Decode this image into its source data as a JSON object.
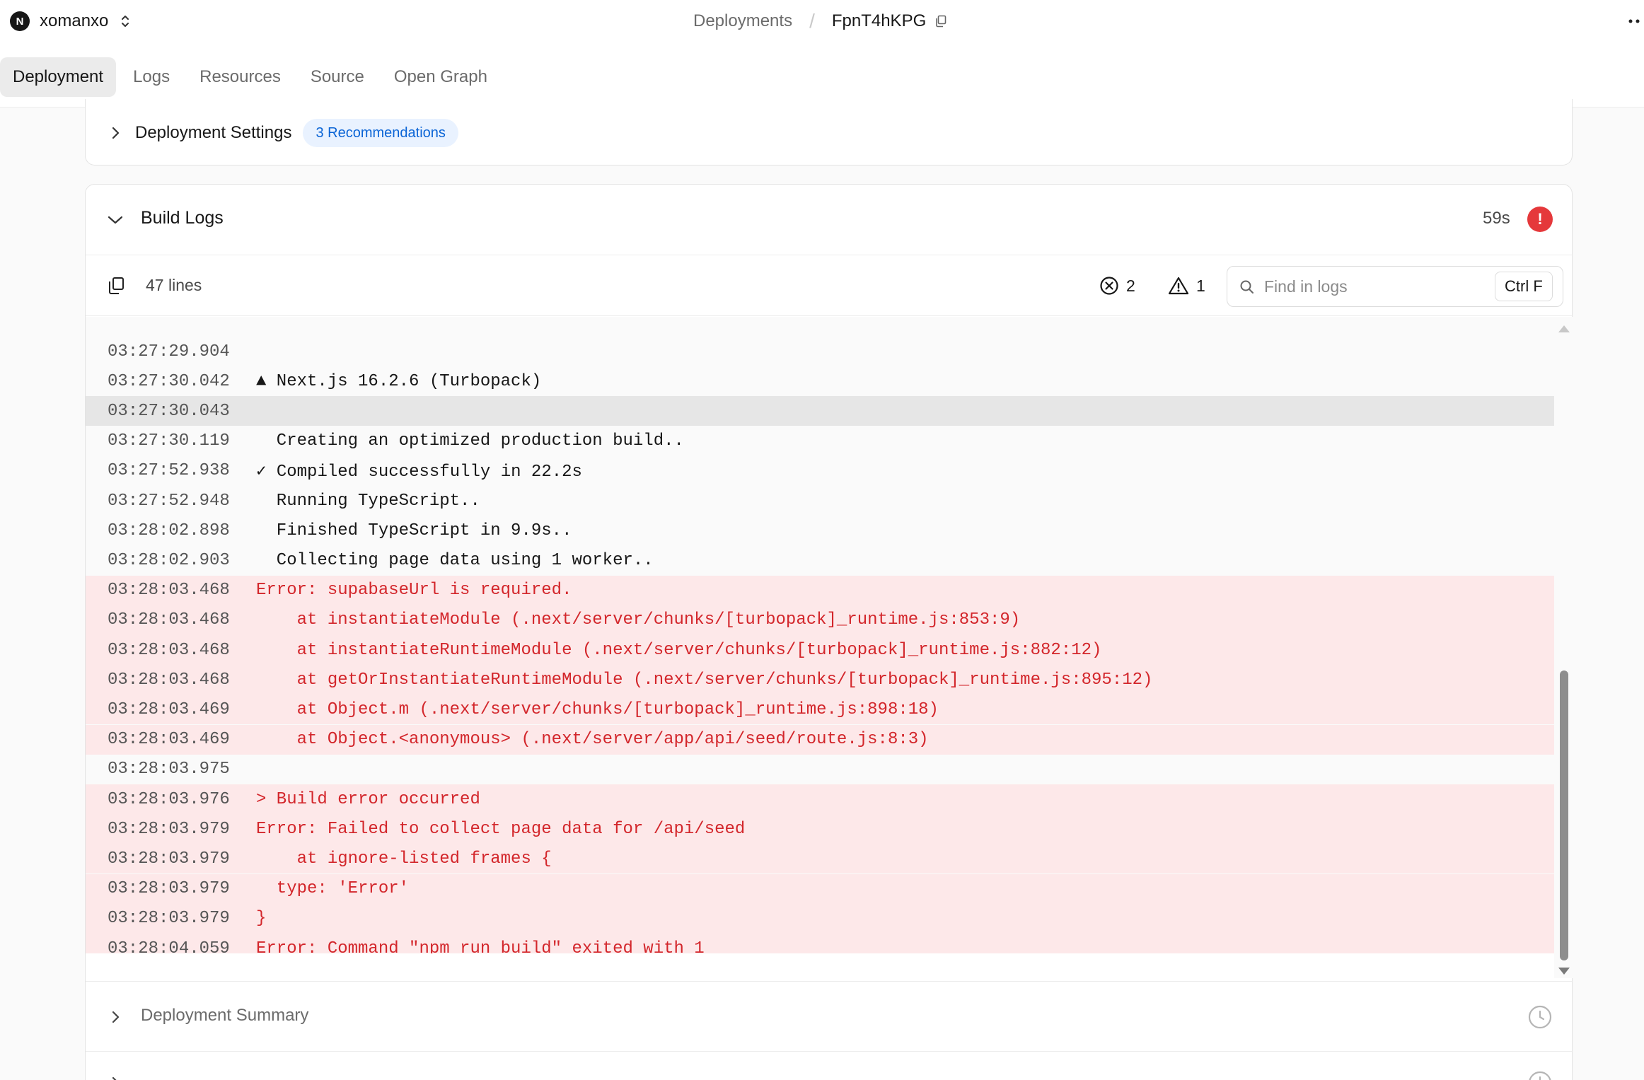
{
  "header": {
    "team_initial": "N",
    "team_name": "xomanxo",
    "breadcrumb_parent": "Deployments",
    "breadcrumb_current": "FpnT4hKPG"
  },
  "tabs": [
    {
      "label": "Deployment",
      "active": true
    },
    {
      "label": "Logs",
      "active": false
    },
    {
      "label": "Resources",
      "active": false
    },
    {
      "label": "Source",
      "active": false
    },
    {
      "label": "Open Graph",
      "active": false
    }
  ],
  "settings": {
    "title": "Deployment Settings",
    "badge": "3 Recommendations"
  },
  "build_logs": {
    "title": "Build Logs",
    "duration": "59s",
    "status_icon": "error-icon",
    "line_count": "47 lines",
    "error_count": "2",
    "warning_count": "1",
    "search_placeholder": "Find in logs",
    "shortcut": "Ctrl F",
    "lines": [
      {
        "time": "03:27:29.904",
        "text": "",
        "type": "normal"
      },
      {
        "time": "03:27:30.042",
        "text": "▲ Next.js 16.2.6 (Turbopack)",
        "type": "normal"
      },
      {
        "time": "03:27:30.043",
        "text": "",
        "type": "selected"
      },
      {
        "time": "03:27:30.119",
        "text": "  Creating an optimized production build..",
        "type": "normal"
      },
      {
        "time": "03:27:52.938",
        "text": "✓ Compiled successfully in 22.2s",
        "type": "normal"
      },
      {
        "time": "03:27:52.948",
        "text": "  Running TypeScript..",
        "type": "normal"
      },
      {
        "time": "03:28:02.898",
        "text": "  Finished TypeScript in 9.9s..",
        "type": "normal"
      },
      {
        "time": "03:28:02.903",
        "text": "  Collecting page data using 1 worker..",
        "type": "normal"
      },
      {
        "time": "03:28:03.468",
        "text": "Error: supabaseUrl is required.",
        "type": "error"
      },
      {
        "time": "03:28:03.468",
        "text": "    at instantiateModule (.next/server/chunks/[turbopack]_runtime.js:853:9)",
        "type": "error"
      },
      {
        "time": "03:28:03.468",
        "text": "    at instantiateRuntimeModule (.next/server/chunks/[turbopack]_runtime.js:882:12)",
        "type": "error"
      },
      {
        "time": "03:28:03.468",
        "text": "    at getOrInstantiateRuntimeModule (.next/server/chunks/[turbopack]_runtime.js:895:12)",
        "type": "error"
      },
      {
        "time": "03:28:03.469",
        "text": "    at Object.m (.next/server/chunks/[turbopack]_runtime.js:898:18)",
        "type": "error"
      },
      {
        "time": "03:28:03.469",
        "text": "    at Object.<anonymous> (.next/server/app/api/seed/route.js:8:3)",
        "type": "error"
      },
      {
        "time": "03:28:03.975",
        "text": "",
        "type": "normal"
      },
      {
        "time": "03:28:03.976",
        "text": "> Build error occurred",
        "type": "error"
      },
      {
        "time": "03:28:03.979",
        "text": "Error: Failed to collect page data for /api/seed",
        "type": "error"
      },
      {
        "time": "03:28:03.979",
        "text": "    at ignore-listed frames {",
        "type": "error"
      },
      {
        "time": "03:28:03.979",
        "text": "  type: 'Error'",
        "type": "error"
      },
      {
        "time": "03:28:03.979",
        "text": "}",
        "type": "error"
      },
      {
        "time": "03:28:04.059",
        "text": "Error: Command \"npm run build\" exited with 1",
        "type": "error"
      }
    ]
  },
  "summary": {
    "title": "Deployment Summary"
  }
}
